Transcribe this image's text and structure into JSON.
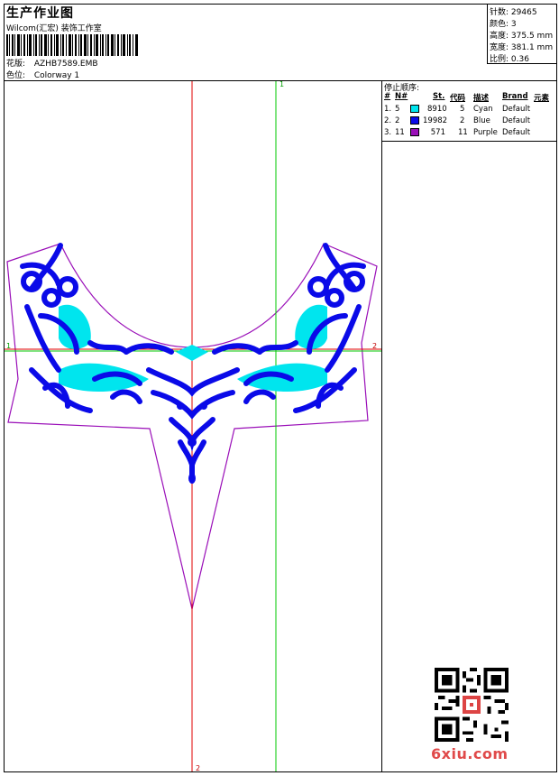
{
  "header": {
    "title": "生产作业图",
    "subtitle": "Wilcom(汇宏) 装饰工作室",
    "design_label": "花版:",
    "design_value": "AZHB7589.EMB",
    "colorway_label": "色位:",
    "colorway_value": "Colorway 1"
  },
  "stats": {
    "stitches_label": "针数:",
    "stitches_value": "29465",
    "colors_label": "颜色:",
    "colors_value": "3",
    "height_label": "高度:",
    "height_value": "375.5 mm",
    "width_label": "宽度:",
    "width_value": "381.1 mm",
    "scale_label": "比例:",
    "scale_value": "0.36"
  },
  "stop_sequence": {
    "caption": "停止顺序:",
    "columns": [
      "#",
      "N#",
      "St.",
      "代码",
      "描述",
      "Brand",
      "元素"
    ],
    "rows": [
      {
        "idx": "1.",
        "n": "5",
        "color": "#00e5ee",
        "st": "8910",
        "code": "5",
        "desc": "Cyan",
        "brand": "Default"
      },
      {
        "idx": "2.",
        "n": "2",
        "color": "#0a0ae8",
        "st": "19982",
        "code": "2",
        "desc": "Blue",
        "brand": "Default"
      },
      {
        "idx": "3.",
        "n": "11",
        "color": "#9a0fb8",
        "st": "571",
        "code": "11",
        "desc": "Purple",
        "brand": "Default"
      }
    ]
  },
  "guides": {
    "v_red_top": "",
    "v_red_bottom": "2",
    "v_green_top": "1",
    "h_green_left": "1",
    "h_red_right": "2"
  },
  "watermark": {
    "qr_icon": "qr-code-icon",
    "brand": "6xiu.com"
  },
  "colors": {
    "cyan": "#00e5ee",
    "blue": "#0a0ae8",
    "purple": "#9a0fb8",
    "guide_red": "#e00000",
    "guide_green": "#00c800"
  }
}
